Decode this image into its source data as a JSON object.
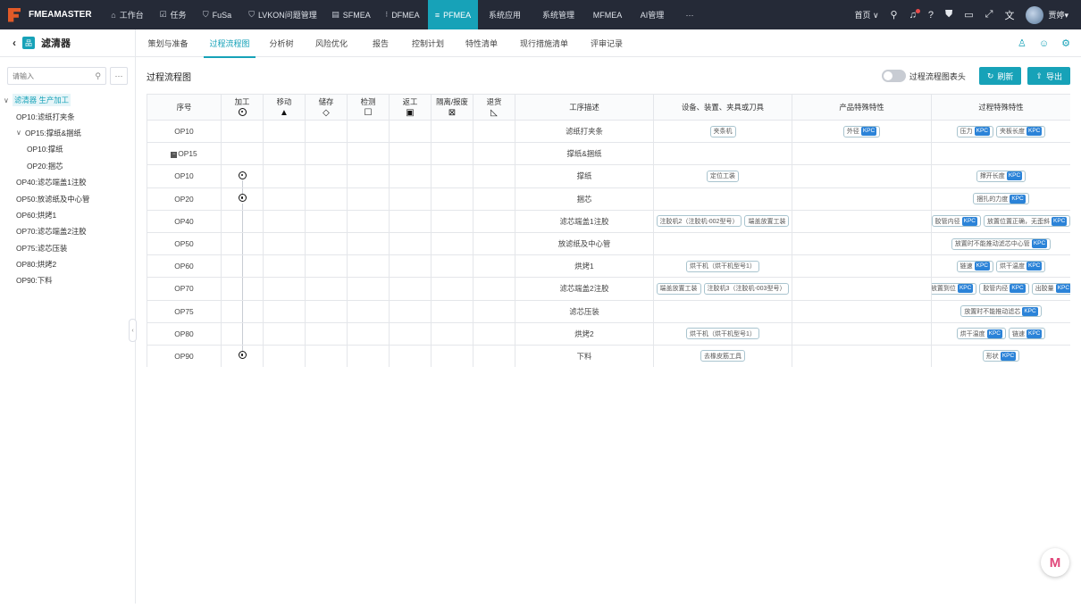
{
  "app": {
    "name": "FMEAMASTER",
    "brand_color": "#e15a28",
    "accent": "#17a2b8"
  },
  "topnav": [
    {
      "icon": "home-icon",
      "glyph": "⌂",
      "label": "工作台",
      "w": 55
    },
    {
      "icon": "checkbox-icon",
      "glyph": "☑",
      "label": "任务",
      "w": 47
    },
    {
      "icon": "shield-icon",
      "glyph": "⛉",
      "label": "FuSa",
      "w": 52
    },
    {
      "icon": "shield-icon",
      "glyph": "⛉",
      "label": "LVKON问题管理",
      "w": 95
    },
    {
      "icon": "table-icon",
      "glyph": "▤",
      "label": "SFMEA",
      "w": 58
    },
    {
      "icon": "bracket-icon",
      "glyph": "⁝",
      "label": "DFMEA",
      "w": 57
    },
    {
      "icon": "list-icon",
      "glyph": "≡",
      "label": "PFMEA",
      "w": 56,
      "active": true
    },
    {
      "icon": "",
      "glyph": "",
      "label": "系统应用",
      "w": 60
    },
    {
      "icon": "",
      "glyph": "",
      "label": "系统管理",
      "w": 60
    },
    {
      "icon": "",
      "glyph": "",
      "label": "MFMEA",
      "w": 50
    },
    {
      "icon": "",
      "glyph": "",
      "label": "AI管理",
      "w": 50
    },
    {
      "icon": "",
      "glyph": "",
      "label": "···",
      "w": 34
    }
  ],
  "topright": {
    "home": "首页",
    "user": "贾婷"
  },
  "project": {
    "name": "滤清器"
  },
  "tabs": [
    {
      "label": "策划与准备",
      "w": 72
    },
    {
      "label": "过程流程图",
      "w": 66,
      "active": true
    },
    {
      "label": "分析树",
      "w": 50
    },
    {
      "label": "风险优化",
      "w": 62
    },
    {
      "label": "报告",
      "w": 48
    },
    {
      "label": "控制计划",
      "w": 58
    },
    {
      "label": "特性清单",
      "w": 62
    },
    {
      "label": "现行措施清单",
      "w": 78
    },
    {
      "label": "评审记录",
      "w": 62
    }
  ],
  "sidebar": {
    "search_placeholder": "请输入",
    "more": "···",
    "tree": [
      {
        "label": "滤清器 生产加工",
        "indent": 4,
        "caret": "∨",
        "sel": true
      },
      {
        "label": "OP10:滤纸打夹条",
        "indent": 18,
        "caret": ""
      },
      {
        "label": "OP15:撑纸&捆纸",
        "indent": 18,
        "caret": "∨"
      },
      {
        "label": "OP10:撑纸",
        "indent": 30,
        "caret": ""
      },
      {
        "label": "OP20:捆芯",
        "indent": 30,
        "caret": ""
      },
      {
        "label": "OP40:滤芯端盖1注胶",
        "indent": 18,
        "caret": ""
      },
      {
        "label": "OP50:放滤纸及中心管",
        "indent": 18,
        "caret": ""
      },
      {
        "label": "OP60:烘烤1",
        "indent": 18,
        "caret": ""
      },
      {
        "label": "OP70:滤芯端盖2注胶",
        "indent": 18,
        "caret": ""
      },
      {
        "label": "OP75:滤芯压装",
        "indent": 18,
        "caret": ""
      },
      {
        "label": "OP80:烘烤2",
        "indent": 18,
        "caret": ""
      },
      {
        "label": "OP90:下料",
        "indent": 18,
        "caret": ""
      }
    ]
  },
  "main": {
    "title": "过程流程图",
    "toggle_label": "过程流程图表头",
    "refresh": "刷新",
    "export": "导出"
  },
  "table": {
    "headers": {
      "seq": "序号",
      "process": "加工",
      "move": "移动",
      "store": "储存",
      "inspect": "检测",
      "rework": "返工",
      "isolate": "隔离/报废",
      "return": "退货",
      "desc": "工序描述",
      "equip": "设备、装置、夹具或刀具",
      "product": "产品特殊特性",
      "processchar": "过程特殊特性"
    },
    "symbols": {
      "move": "▲",
      "store": "◇",
      "inspect": "☐",
      "rework": "▣",
      "isolate": "⊠",
      "return": "◺"
    },
    "kpc": "KPC",
    "rows": [
      {
        "seq": "OP10",
        "op": false,
        "desc": "滤纸打夹条",
        "equip": [
          "夹条机"
        ],
        "product": [
          "外径"
        ],
        "pchar": [
          "压力",
          "夹板长度"
        ]
      },
      {
        "seq": "OP15",
        "group": true,
        "op": false,
        "desc": "撑纸&捆纸",
        "equip": [],
        "product": [],
        "pchar": []
      },
      {
        "seq": "OP10",
        "op": true,
        "desc": "撑纸",
        "equip": [
          "定位工装"
        ],
        "product": [],
        "pchar": [
          "撑开长度"
        ]
      },
      {
        "seq": "OP20",
        "op": true,
        "desc": "捆芯",
        "equip": [],
        "product": [],
        "pchar": [
          "捆扎的力度"
        ]
      },
      {
        "seq": "OP40",
        "op": false,
        "desc": "滤芯端盖1注胶",
        "equip": [
          "注胶机2（注胶机-002型号）",
          "端盖放置工装"
        ],
        "product": [],
        "pchar": [
          "胶管内径",
          "放置位置正确，无歪斜"
        ]
      },
      {
        "seq": "OP50",
        "op": false,
        "desc": "放滤纸及中心管",
        "equip": [],
        "product": [],
        "pchar": [
          "放置时不能推动滤芯中心管"
        ]
      },
      {
        "seq": "OP60",
        "op": false,
        "desc": "烘烤1",
        "equip": [
          "烘干机（烘干机型号1）"
        ],
        "product": [],
        "pchar": [
          "链速",
          "烘干温度"
        ]
      },
      {
        "seq": "OP70",
        "op": false,
        "desc": "滤芯端盖2注胶",
        "equip": [
          "端盖放置工装",
          "注胶机3（注胶机-003型号）"
        ],
        "product": [],
        "pchar": [
          "放置到位",
          "胶管内径",
          "出胶量"
        ]
      },
      {
        "seq": "OP75",
        "op": false,
        "desc": "滤芯压装",
        "equip": [],
        "product": [],
        "pchar": [
          "放置时不能推动滤芯"
        ]
      },
      {
        "seq": "OP80",
        "op": false,
        "desc": "烘烤2",
        "equip": [
          "烘干机（烘干机型号1）"
        ],
        "product": [],
        "pchar": [
          "烘干温度",
          "链速"
        ]
      },
      {
        "seq": "OP90",
        "op": true,
        "desc": "下料",
        "equip": [
          "去橡皮筋工具"
        ],
        "product": [],
        "pchar": [
          "形状"
        ]
      }
    ]
  }
}
